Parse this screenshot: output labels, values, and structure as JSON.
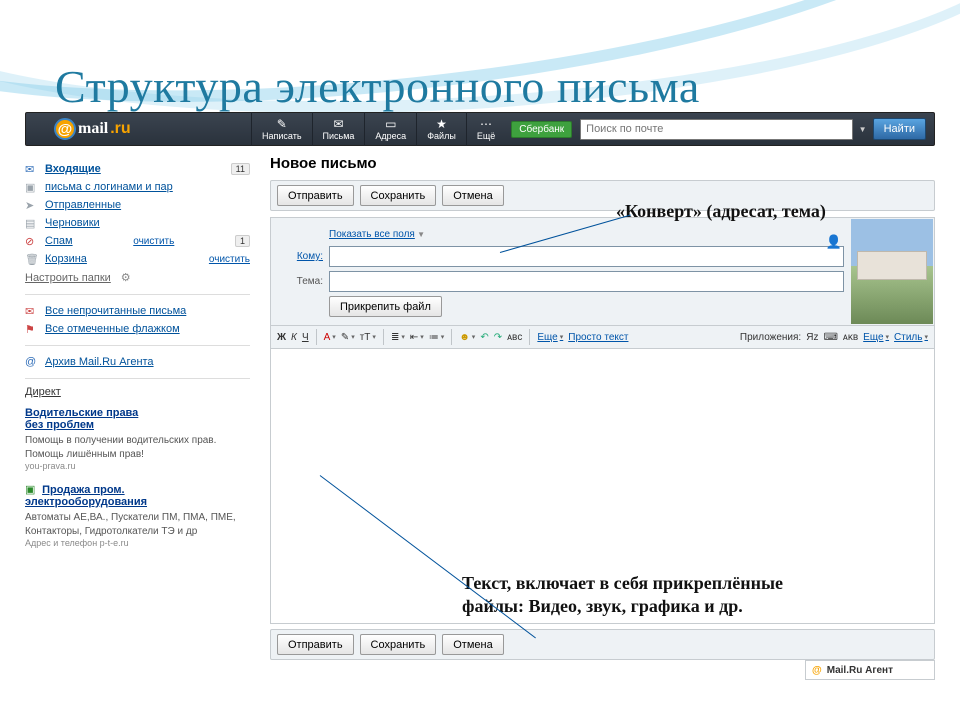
{
  "slide_title": "Структура электронного письма",
  "logo": {
    "mail": "mail",
    "ru": ".ru"
  },
  "toolbar": {
    "write": "Написать",
    "mail": "Письма",
    "addr": "Адреса",
    "files": "Файлы",
    "more": "Ещё",
    "sber": "Сбербанк",
    "search_ph": "Поиск по почте",
    "go": "Найти"
  },
  "side": {
    "inbox": "Входящие",
    "inbox_n": "11",
    "fldr": "письма с логинами и пар",
    "sent": "Отправленные",
    "drafts": "Черновики",
    "spam": "Спам",
    "spam_clear": "очистить",
    "spam_n": "1",
    "trash": "Корзина",
    "trash_clear": "очистить",
    "setup": "Настроить папки",
    "unread": "Все непрочитанные письма",
    "flagged": "Все отмеченные флажком",
    "agent_arch": "Архив Mail.Ru Агента",
    "direct": "Директ",
    "ad1_h1": "Водительские права",
    "ad1_h2": "без проблем",
    "ad1_txt": "Помощь в получении водительских прав. Помощь лишённым прав!",
    "ad1_url": "you-prava.ru",
    "ad2_h1": "Продажа пром.",
    "ad2_h2": "электрооборудования",
    "ad2_txt": "Автоматы АЕ,ВА., Пускатели ПМ, ПМА, ПМЕ, Контакторы, Гидротолкатели ТЭ и др",
    "ad2_url": "Адрес и телефон  p-t-e.ru"
  },
  "pane": {
    "title": "Новое письмо",
    "send": "Отправить",
    "save": "Сохранить",
    "cancel": "Отмена",
    "allfields": "Показать все поля",
    "to": "Кому:",
    "subj": "Тема:",
    "attach": "Прикрепить файл",
    "plain": "Просто текст",
    "apps": "Приложения:",
    "more2": "Еще",
    "style": "Стиль"
  },
  "agent": "Mail.Ru Агент",
  "ann": {
    "env": "«Конверт» (адресат, тема)",
    "body": "Текст, включает в себя прикреплённые файлы: Видео, звук, графика и др."
  }
}
